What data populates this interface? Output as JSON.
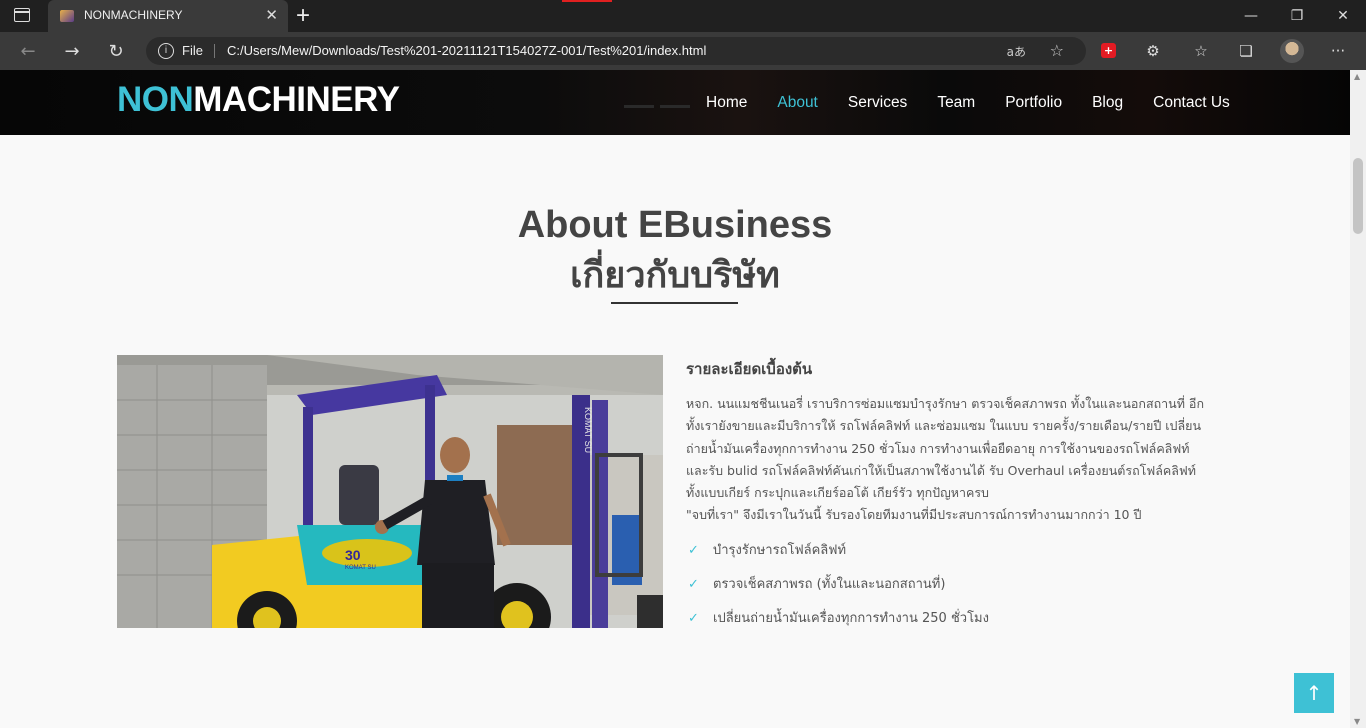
{
  "browser": {
    "tab_title": "NONMACHINERY",
    "tab_close": "✕",
    "new_tab": "+",
    "file_label": "File",
    "url": "C:/Users/Mew/Downloads/Test%201-20211121T154027Z-001/Test%201/index.html",
    "read_aloud": "aあ",
    "window": {
      "minimize": "—",
      "restore": "❐",
      "close": "✕"
    },
    "nav": {
      "back": "←",
      "forward": "→",
      "refresh": "↻"
    },
    "tools": {
      "extensions": "⚙",
      "favorites": "☆",
      "collections": "❏",
      "more": "···"
    }
  },
  "site": {
    "logo": {
      "part1": "NON",
      "part2": "MACHINERY"
    },
    "menu": [
      {
        "label": "Home"
      },
      {
        "label": "About"
      },
      {
        "label": "Services"
      },
      {
        "label": "Team"
      },
      {
        "label": "Portfolio"
      },
      {
        "label": "Blog"
      },
      {
        "label": "Contact Us"
      }
    ],
    "active_menu": "About",
    "section": {
      "title_en": "About EBusiness",
      "title_th": "เกี่ยวกับบริษัท"
    },
    "about": {
      "heading": "รายละเอียดเบื้องต้น",
      "body": "หจก. นนแมชชีนเนอรี่ เราบริการซ่อมแซมบำรุงรักษา ตรวจเช็คสภาพรถ ทั้งในและนอกสถานที่ อีก\nทั้งเรายังขายและมีบริการให้ รถโฟล์คลิฟท์ และซ่อมแซม ในแบบ รายครั้ง/รายเดือน/รายปี เปลี่ยน\nถ่ายน้ำมันเครื่องทุกการทำงาน 250 ชั่วโมง การทำงานเพื่อยืดอายุ การใช้งานของรถโฟล์คลิฟท์\nและรับ bulid รถโฟล์คลิฟท์คันเก่าให้เป็นสภาพใช้งานได้ รับ Overhaul เครื่องยนต์รถโฟล์คลิฟท์\nทั้งแบบเกียร์ กระปุกและเกียร์ออโต้ เกียร์รัว ทุกปัญหาครบ\n\"จบที่เรา\" จึงมีเราในวันนี้ รับรองโดยทีมงานที่มีประสบการณ์การทำงานมากกว่า 10 ปี",
      "bullets": [
        "บำรุงรักษารถโฟล์คลิฟท์",
        "ตรวจเช็คสภาพรถ (ทั้งในและนอกสถานที่)",
        "เปลี่ยนถ่ายน้ำมันเครื่องทุกการทำงาน 250 ชั่วโมง"
      ],
      "photo_labels": {
        "forklift_side": "30",
        "forklift_brand": "KOMAT SU",
        "mast_brand": "KOMAT SU"
      }
    },
    "back_to_top": "↑",
    "accent_color": "#3ec1d5"
  }
}
